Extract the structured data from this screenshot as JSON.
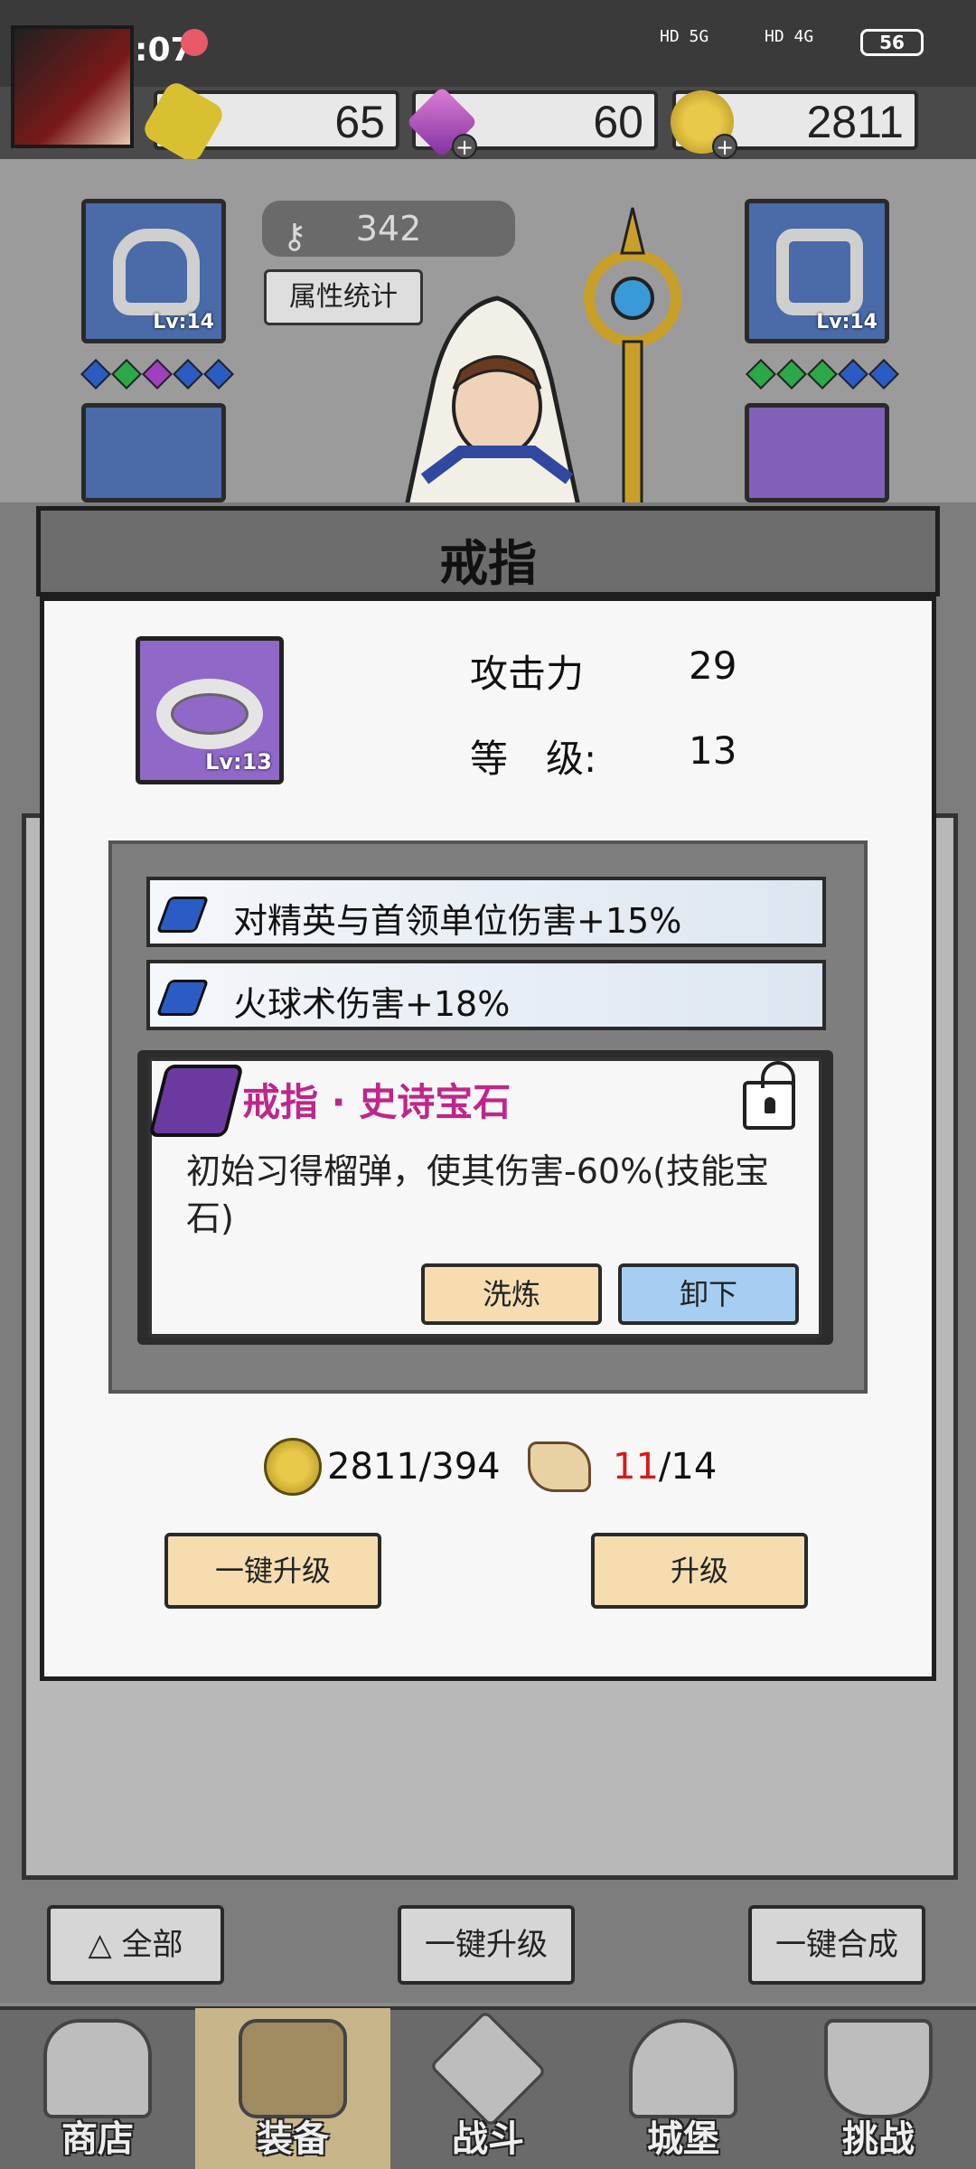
{
  "status_bar": {
    "time": "下午1:07",
    "network_1": "HD 5G",
    "network_2": "HD 4G",
    "battery": "56"
  },
  "resources": {
    "gold_hex": "65",
    "gems": "60",
    "coins": "2811"
  },
  "hero": {
    "key_count": "342",
    "attr_button": "属性统计",
    "equip_top_left_lv": "Lv:14",
    "equip_top_right_lv": "Lv:14"
  },
  "modal": {
    "title": "戒指",
    "item_level_badge": "Lv:13",
    "stats": [
      {
        "label": "攻击力",
        "value": "29"
      },
      {
        "label": "等　级:",
        "value": "13"
      }
    ],
    "bonuses": [
      "对精英与首领单位伤害+15%",
      "火球术伤害+18%"
    ],
    "epic_gem": {
      "title": "戒指 · 史诗宝石",
      "description": "初始习得榴弹，使其伤害-60%(技能宝石)",
      "reroll_label": "洗炼",
      "unequip_label": "卸下"
    },
    "cost": {
      "coins": "2811/394",
      "scrolls_have": "11",
      "scrolls_need": "/14"
    },
    "upgrade_all_label": "一键升级",
    "upgrade_label": "升级"
  },
  "bottom_actions": {
    "filter_label": "全部",
    "upgrade_all_label": "一键升级",
    "merge_all_label": "一键合成"
  },
  "nav": [
    {
      "label": "商店"
    },
    {
      "label": "装备"
    },
    {
      "label": "战斗"
    },
    {
      "label": "城堡"
    },
    {
      "label": "挑战"
    }
  ]
}
